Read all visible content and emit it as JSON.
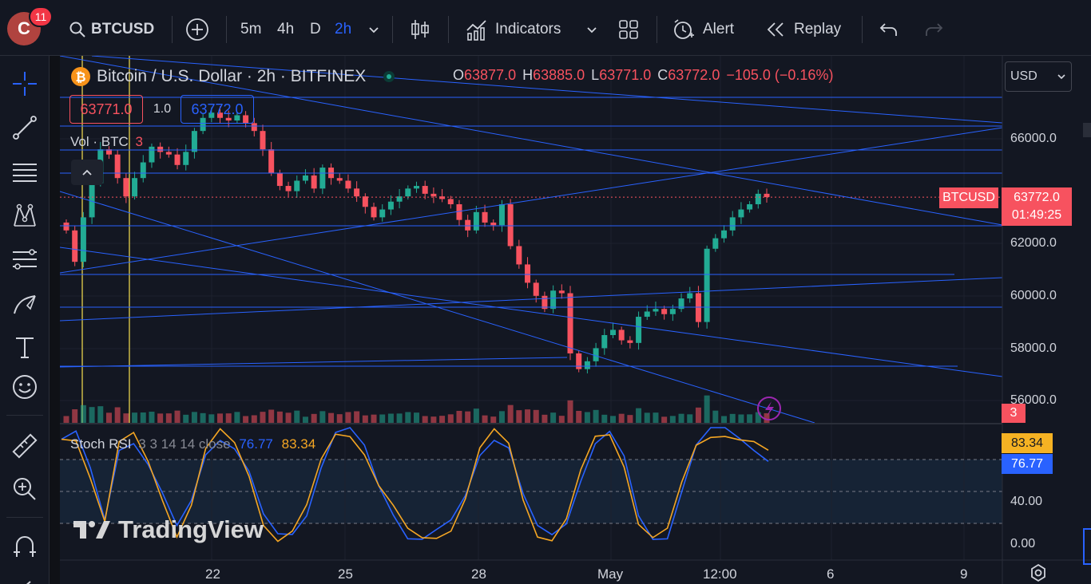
{
  "toolbar": {
    "avatar_letter": "C",
    "notifications": "11",
    "symbol": "BTCUSD",
    "intervals": [
      "5m",
      "4h",
      "D",
      "2h"
    ],
    "indicators_label": "Indicators",
    "alert_label": "Alert",
    "replay_label": "Replay"
  },
  "legend": {
    "title": "Bitcoin / U.S. Dollar · 2h · BITFINEX",
    "open_key": "O",
    "open": "63877.0",
    "high_key": "H",
    "high": "63885.0",
    "low_key": "L",
    "low": "63771.0",
    "close_key": "C",
    "close": "63772.0",
    "change": "−105.0 (−0.16%)",
    "bid": "63771.0",
    "spread": "1.0",
    "ask": "63772.0",
    "vol_label": "Vol · BTC",
    "vol_value": "3"
  },
  "stoch": {
    "label": "Stoch RSI",
    "params": "3 3 14 14 close",
    "k_value": "76.77",
    "d_value": "83.34",
    "axis_labels": [
      "40.00",
      "0.00"
    ]
  },
  "price_axis": {
    "currency": "USD",
    "labels": [
      "66000.0",
      "62000.0",
      "60000.0",
      "58000.0",
      "56000.0"
    ],
    "symbol_tag": "BTCUSD",
    "last_price": "63772.0",
    "countdown": "01:49:25",
    "volume_tag": "3"
  },
  "time_axis": [
    "22",
    "25",
    "28",
    "May",
    "12:00",
    "6",
    "9"
  ],
  "watermark": "TradingView",
  "colors": {
    "up": "#22ab94",
    "down": "#f7525f",
    "line": "#2962ff",
    "k": "#2962ff",
    "d": "#f5a623",
    "accent": "#2962ff"
  },
  "chart_data": {
    "type": "candlestick",
    "ylim": [
      55500,
      68000
    ],
    "candles_close": [
      62500,
      61300,
      63000,
      64300,
      65600,
      65400,
      64500,
      63800,
      64500,
      65100,
      65700,
      65500,
      65400,
      65000,
      65500,
      66300,
      66800,
      67000,
      66800,
      66700,
      66900,
      66600,
      66300,
      65600,
      64700,
      64200,
      64000,
      64400,
      64600,
      64100,
      64900,
      64500,
      64400,
      64100,
      63800,
      63400,
      63000,
      63300,
      63600,
      63800,
      64100,
      64200,
      63900,
      63800,
      63700,
      63500,
      62900,
      62500,
      63200,
      62800,
      62700,
      63500,
      61900,
      61200,
      60500,
      60000,
      59500,
      60200,
      60100,
      57800,
      57200,
      57500,
      58000,
      58500,
      58700,
      58300,
      58200,
      59200,
      59400,
      59500,
      59300,
      59500,
      59900,
      60100,
      59000,
      61800,
      62200,
      62500,
      63000,
      63300,
      63500,
      63900,
      63772
    ],
    "stoch_k_last": 76.77,
    "stoch_d_last": 83.34
  }
}
